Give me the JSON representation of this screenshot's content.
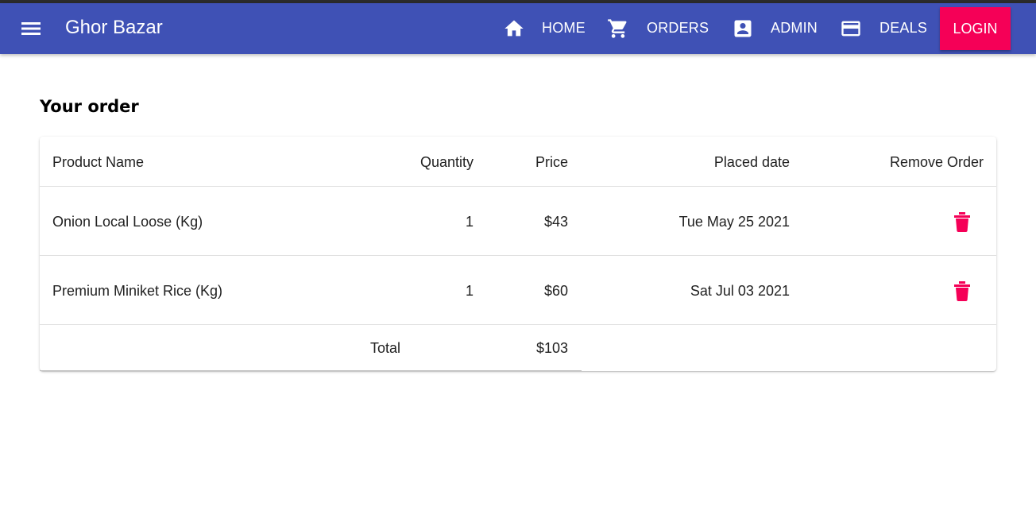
{
  "app": {
    "title": "Ghor Bazar"
  },
  "nav": {
    "home": {
      "label": "HOME",
      "icon": "home-icon"
    },
    "orders": {
      "label": "ORDERS",
      "icon": "cart-icon"
    },
    "admin": {
      "label": "ADMIN",
      "icon": "account-box-icon"
    },
    "deals": {
      "label": "DEALS",
      "icon": "credit-card-icon"
    },
    "login": {
      "label": "LOGIN"
    }
  },
  "colors": {
    "appbar": "#3f51b5",
    "accent": "#f50057"
  },
  "page": {
    "heading": "Your order"
  },
  "table": {
    "headers": {
      "product": "Product Name",
      "quantity": "Quantity",
      "price": "Price",
      "date": "Placed date",
      "remove": "Remove Order"
    },
    "rows": [
      {
        "product": "Onion Local Loose (Kg)",
        "quantity": "1",
        "price": "$43",
        "date": "Tue May 25 2021"
      },
      {
        "product": "Premium Miniket Rice (Kg)",
        "quantity": "1",
        "price": "$60",
        "date": "Sat Jul 03 2021"
      }
    ],
    "total": {
      "label": "Total",
      "value": "$103"
    }
  }
}
